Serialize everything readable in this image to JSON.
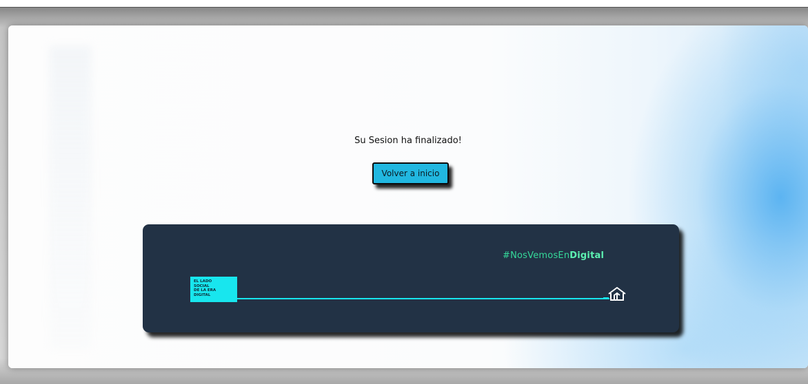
{
  "session": {
    "message": "Su Sesion ha finalizado!",
    "button_label": "Volver a inicio"
  },
  "banner": {
    "hashtag_prefix": "#NosVemosEn",
    "hashtag_emphasis": "Digital",
    "logo_lines": [
      "EL LADO",
      "SOCIAL",
      "DE LA ERA",
      "DIGITAL"
    ],
    "icon": "house-icon",
    "colors": {
      "background": "#223245",
      "accent": "#18e6ee",
      "hashtag": "#35d99a"
    }
  },
  "colors": {
    "button": "#21b7e0"
  }
}
